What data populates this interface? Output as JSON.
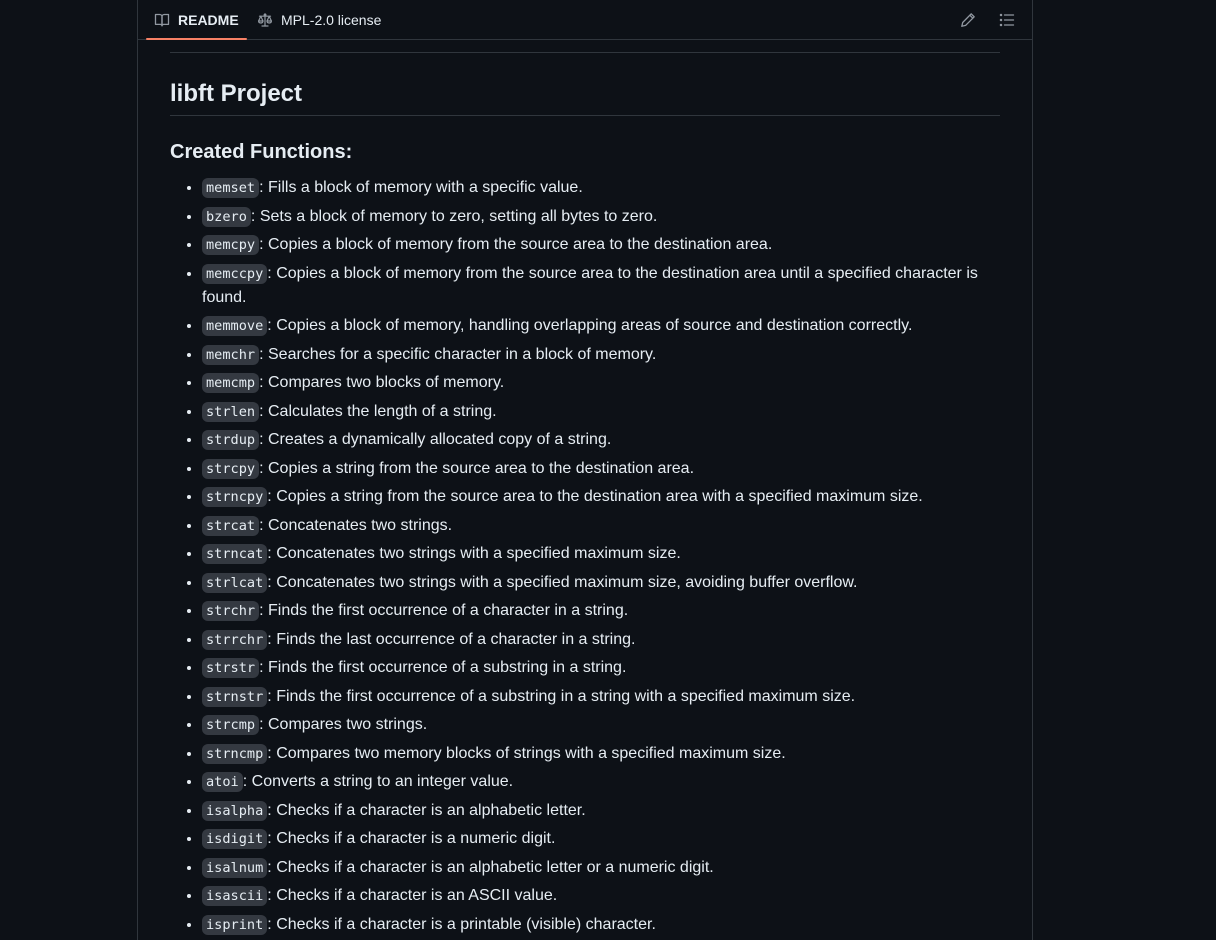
{
  "tabs": [
    {
      "label": "README",
      "icon": "book-icon",
      "active": true
    },
    {
      "label": "MPL-2.0 license",
      "icon": "law-scale-icon",
      "active": false
    }
  ],
  "toolbar": {
    "edit_icon": "pencil-icon",
    "outline_icon": "list-unordered-icon"
  },
  "colors": {
    "background": "#0d1117",
    "border": "#30363d",
    "active_tab_underline": "#f78166",
    "code_background": "#343941",
    "text": "#e6edf3"
  },
  "readme": {
    "title": "libft Project",
    "section_heading": "Created Functions:",
    "functions": [
      {
        "name": "memset",
        "description": ": Fills a block of memory with a specific value."
      },
      {
        "name": "bzero",
        "description": ": Sets a block of memory to zero, setting all bytes to zero."
      },
      {
        "name": "memcpy",
        "description": ": Copies a block of memory from the source area to the destination area."
      },
      {
        "name": "memccpy",
        "description": ": Copies a block of memory from the source area to the destination area until a specified character is found."
      },
      {
        "name": "memmove",
        "description": ": Copies a block of memory, handling overlapping areas of source and destination correctly."
      },
      {
        "name": "memchr",
        "description": ": Searches for a specific character in a block of memory."
      },
      {
        "name": "memcmp",
        "description": ": Compares two blocks of memory."
      },
      {
        "name": "strlen",
        "description": ": Calculates the length of a string."
      },
      {
        "name": "strdup",
        "description": ": Creates a dynamically allocated copy of a string."
      },
      {
        "name": "strcpy",
        "description": ": Copies a string from the source area to the destination area."
      },
      {
        "name": "strncpy",
        "description": ": Copies a string from the source area to the destination area with a specified maximum size."
      },
      {
        "name": "strcat",
        "description": ": Concatenates two strings."
      },
      {
        "name": "strncat",
        "description": ": Concatenates two strings with a specified maximum size."
      },
      {
        "name": "strlcat",
        "description": ": Concatenates two strings with a specified maximum size, avoiding buffer overflow."
      },
      {
        "name": "strchr",
        "description": ": Finds the first occurrence of a character in a string."
      },
      {
        "name": "strrchr",
        "description": ": Finds the last occurrence of a character in a string."
      },
      {
        "name": "strstr",
        "description": ": Finds the first occurrence of a substring in a string."
      },
      {
        "name": "strnstr",
        "description": ": Finds the first occurrence of a substring in a string with a specified maximum size."
      },
      {
        "name": "strcmp",
        "description": ": Compares two strings."
      },
      {
        "name": "strncmp",
        "description": ": Compares two memory blocks of strings with a specified maximum size."
      },
      {
        "name": "atoi",
        "description": ": Converts a string to an integer value."
      },
      {
        "name": "isalpha",
        "description": ": Checks if a character is an alphabetic letter."
      },
      {
        "name": "isdigit",
        "description": ": Checks if a character is a numeric digit."
      },
      {
        "name": "isalnum",
        "description": ": Checks if a character is an alphabetic letter or a numeric digit."
      },
      {
        "name": "isascii",
        "description": ": Checks if a character is an ASCII value."
      },
      {
        "name": "isprint",
        "description": ": Checks if a character is a printable (visible) character."
      }
    ]
  }
}
